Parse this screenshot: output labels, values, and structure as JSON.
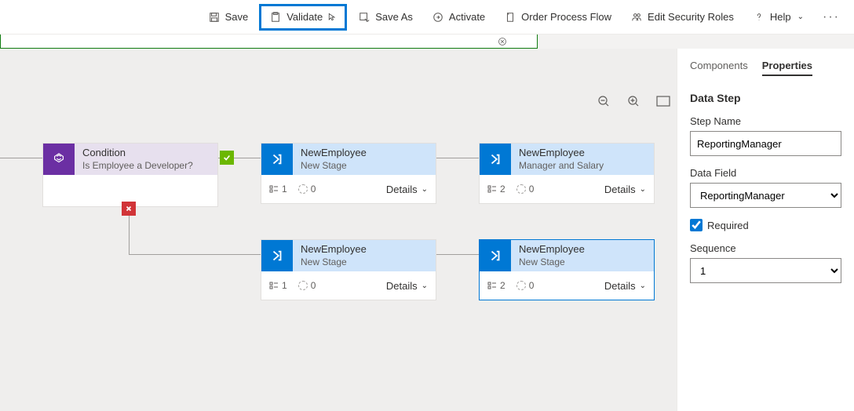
{
  "toolbar": {
    "save_label": "Save",
    "validate_label": "Validate",
    "save_as_label": "Save As",
    "activate_label": "Activate",
    "order_flow_label": "Order Process Flow",
    "edit_roles_label": "Edit Security Roles",
    "help_label": "Help"
  },
  "canvas": {
    "condition": {
      "title": "Condition",
      "subtitle": "Is Employee a Developer?"
    },
    "stages": [
      {
        "title": "NewEmployee",
        "subtitle": "New Stage",
        "count": "1",
        "dotted": "0",
        "details": "Details"
      },
      {
        "title": "NewEmployee",
        "subtitle": "Manager and Salary",
        "count": "2",
        "dotted": "0",
        "details": "Details"
      },
      {
        "title": "NewEmployee",
        "subtitle": "New Stage",
        "count": "1",
        "dotted": "0",
        "details": "Details"
      },
      {
        "title": "NewEmployee",
        "subtitle": "New Stage",
        "count": "2",
        "dotted": "0",
        "details": "Details"
      }
    ]
  },
  "panel": {
    "tabs": {
      "components": "Components",
      "properties": "Properties"
    },
    "heading": "Data Step",
    "step_name_label": "Step Name",
    "step_name_value": "ReportingManager",
    "data_field_label": "Data Field",
    "data_field_value": "ReportingManager",
    "required_label": "Required",
    "sequence_label": "Sequence",
    "sequence_value": "1"
  }
}
